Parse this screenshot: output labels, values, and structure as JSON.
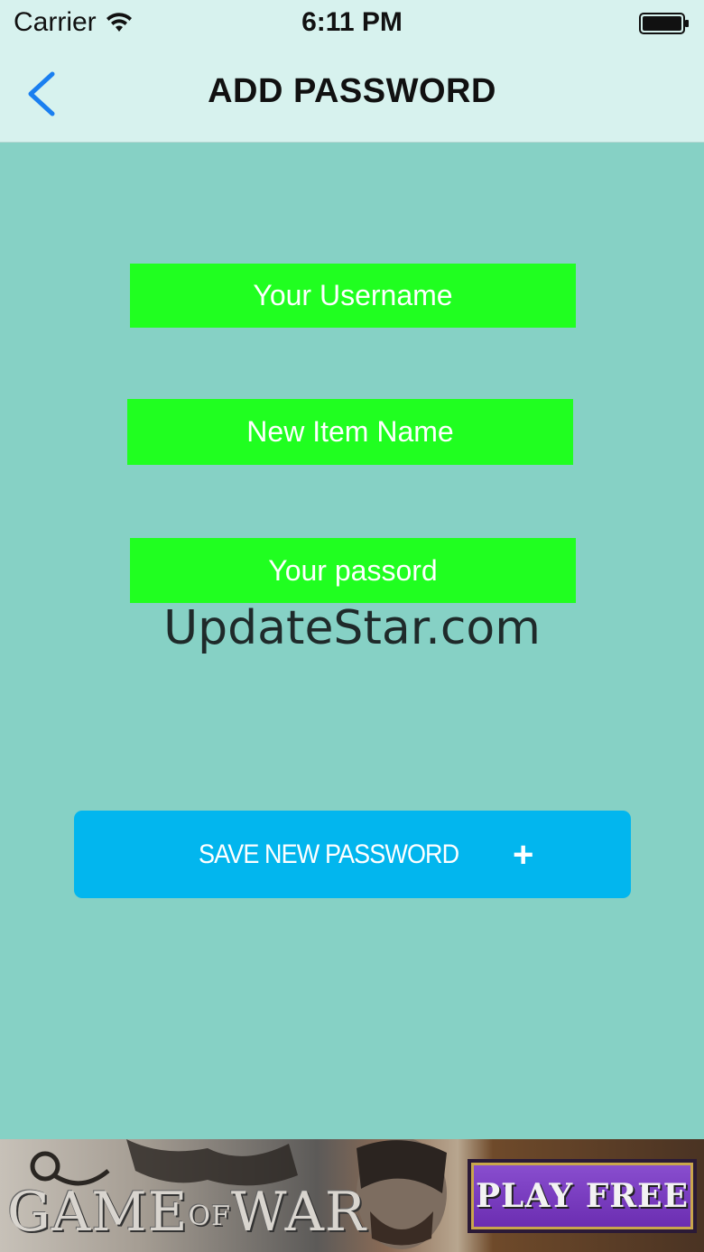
{
  "status_bar": {
    "carrier": "Carrier",
    "time": "6:11 PM",
    "wifi_icon": "wifi-icon",
    "battery_icon": "battery-icon"
  },
  "nav": {
    "title": "ADD PASSWORD",
    "back_icon": "chevron-left-icon"
  },
  "form": {
    "username_placeholder": "Your Username",
    "item_name_placeholder": "New Item Name",
    "password_placeholder": "Your passord",
    "username_value": "",
    "item_name_value": "",
    "password_value": ""
  },
  "watermark": "UpdateStar.com",
  "save_button": {
    "label": "SAVE NEW PASSWORD",
    "icon": "plus-icon",
    "icon_glyph": "+"
  },
  "ad": {
    "logo_text_1": "GAME",
    "logo_text_of": "OF",
    "logo_text_2": "WAR",
    "cta": "PLAY FREE"
  },
  "colors": {
    "background": "#86d1c5",
    "nav_background": "#d7f2ee",
    "field_background": "#20ff20",
    "button_background": "#02b6ee",
    "back_accent": "#1a7ff0"
  }
}
